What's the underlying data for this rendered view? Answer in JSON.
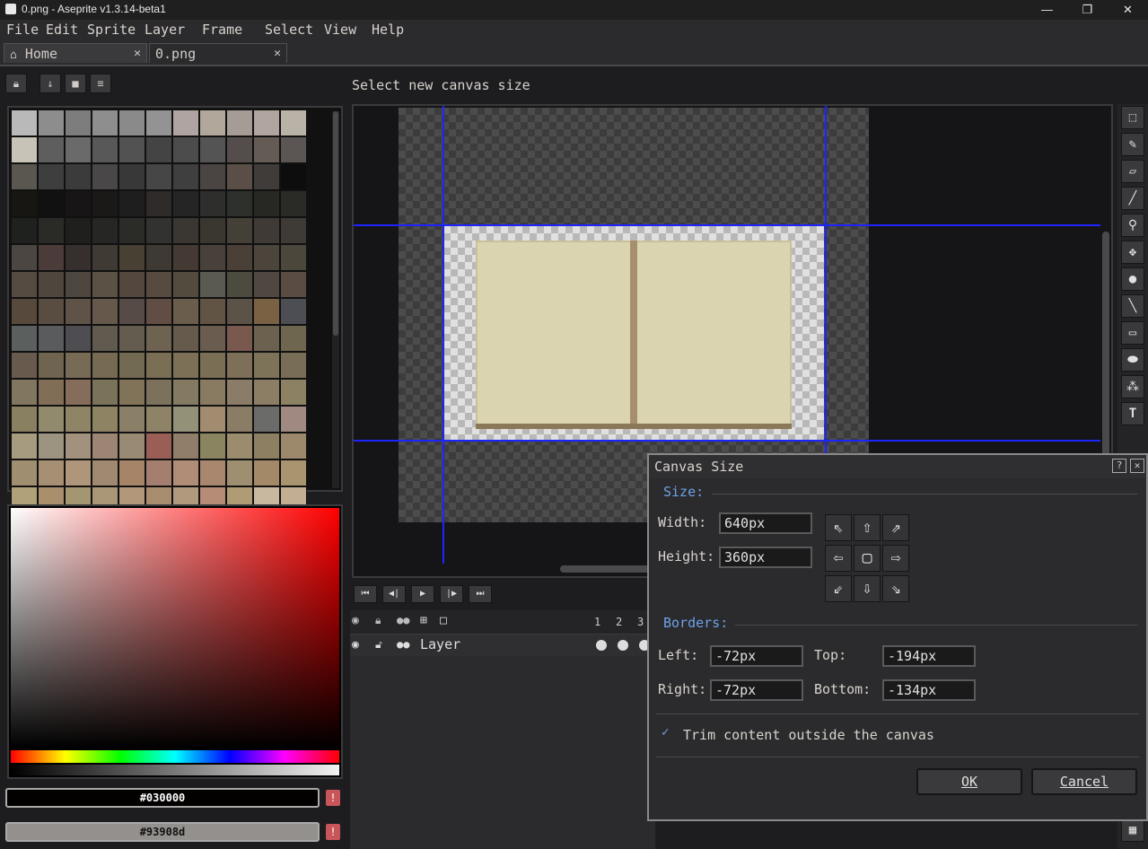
{
  "window": {
    "title": "0.png - Aseprite v1.3.14-beta1",
    "minimize": "—",
    "maximize": "❐",
    "close": "✕"
  },
  "menu": [
    "File",
    "Edit",
    "Sprite",
    "Layer",
    "Frame",
    "Select",
    "View",
    "Help"
  ],
  "tabs": [
    {
      "label": "Home",
      "close": "✕"
    },
    {
      "label": "0.png",
      "close": "✕"
    }
  ],
  "status": "Select new canvas size",
  "palette_colors": [
    "#b9b9b9",
    "#8d8d8d",
    "#7d7d7d",
    "#8e8e8e",
    "#8a8a8a",
    "#939393",
    "#b0a4a3",
    "#b1a89b",
    "#a69c96",
    "#b1a5a0",
    "#b9b2a6",
    "#c7c3b6",
    "#5e5e5e",
    "#6a6a6a",
    "#585858",
    "#525252",
    "#444444",
    "#4c4c4c",
    "#545454",
    "#554c4c",
    "#655b55",
    "#5b5554",
    "#5a5750",
    "#3e3e3e",
    "#3b3b3b",
    "#494747",
    "#383838",
    "#464646",
    "#3f3f3f",
    "#4a4543",
    "#5a4e46",
    "#3f3c3a",
    "#0d0d0d",
    "#171612",
    "#111111",
    "#171515",
    "#1a1918",
    "#1e1e1e",
    "#2e2b28",
    "#252525",
    "#2e2e2c",
    "#2e302c",
    "#272724",
    "#2a2a26",
    "#1f211f",
    "#2a2a27",
    "#1f201e",
    "#262624",
    "#2b2b28",
    "#323230",
    "#3a3632",
    "#3a3731",
    "#444037",
    "#403a36",
    "#3e3a35",
    "#4b4641",
    "#4b3c39",
    "#372f2d",
    "#3f3a33",
    "#474033",
    "#3e3932",
    "#453a33",
    "#48413a",
    "#4b4037",
    "#4c453b",
    "#4c473b",
    "#564b40",
    "#4f463d",
    "#4e473f",
    "#5c5145",
    "#53473e",
    "#574a41",
    "#534b3e",
    "#5a5a52",
    "#4d4a3f",
    "#504740",
    "#5a4c43",
    "#58493d",
    "#584d40",
    "#5e5346",
    "#66594b",
    "#574b47",
    "#624d45",
    "#6b5d4c",
    "#625444",
    "#5b5248",
    "#7a6144",
    "#4c4e54",
    "#5b5f5e",
    "#595b5c",
    "#4e4e52",
    "#605a4f",
    "#655c50",
    "#6e6350",
    "#655a4c",
    "#6a5c4e",
    "#79584e",
    "#6c614f",
    "#6f6650",
    "#685b4d",
    "#6e644f",
    "#786b55",
    "#766a53",
    "#726a52",
    "#7a6e55",
    "#7c7157",
    "#7a6f55",
    "#7e6f59",
    "#7d7358",
    "#786d57",
    "#817760",
    "#826e57",
    "#866c5b",
    "#7a735a",
    "#807358",
    "#7c725c",
    "#847961",
    "#887b62",
    "#8a7c66",
    "#8c7e65",
    "#8d8163",
    "#888060",
    "#918a6c",
    "#8f8566",
    "#8e8363",
    "#8a8068",
    "#8e8367",
    "#939178",
    "#a28c6f",
    "#8b7c66",
    "#6b6b69",
    "#a08981",
    "#a69a7f",
    "#9c9381",
    "#a2917c",
    "#9c8574",
    "#998a73",
    "#9a5e56",
    "#907e6a",
    "#8a8560",
    "#9a8c6d",
    "#8c7f62",
    "#9c896b",
    "#a08e70",
    "#a68f72",
    "#af9579",
    "#9f8970",
    "#a58468",
    "#a47f70",
    "#b08d76",
    "#a8876e",
    "#9e8f70",
    "#a48969",
    "#a8956f",
    "#b1a178",
    "#aa8f6d",
    "#a39671",
    "#a99778",
    "#b3977b",
    "#a88e6e",
    "#b09a7d",
    "#b78c76",
    "#af9b74",
    "#c9b8a0",
    "#c1ae93",
    "#b7a38c",
    "#ad9f83",
    "#bfa98e",
    "#b6a182",
    "#c0a88a",
    "#c7b08f",
    "#b99f82",
    "#c2a98a",
    "#b8a384"
  ],
  "fg_color": "#030000",
  "bg_color": "#93908d",
  "color_warn": "!",
  "tools": [
    "⬚",
    "✎",
    "▱",
    "╱",
    "⚲",
    "✥",
    "●",
    "╲",
    "▭",
    "⬬",
    "⁂",
    "T"
  ],
  "frame_label_icon": "▦",
  "playback": [
    "⏮",
    "◀|",
    "▶",
    "|▶",
    "⏭"
  ],
  "timeline": {
    "frames": [
      "1",
      "2",
      "3"
    ],
    "layer_name": "Layer"
  },
  "dialog": {
    "title": "Canvas Size",
    "help": "?",
    "close": "✕",
    "size_label": "Size:",
    "width_label": "Width:",
    "width_value": "640px",
    "height_label": "Height:",
    "height_value": "360px",
    "anchors": [
      "⇖",
      "⇧",
      "⇗",
      "⇦",
      "▢",
      "⇨",
      "⇙",
      "⇩",
      "⇘"
    ],
    "borders_label": "Borders:",
    "left_label": "Left:",
    "left_value": "-72px",
    "top_label": "Top:",
    "top_value": "-194px",
    "right_label": "Right:",
    "right_value": "-72px",
    "bottom_label": "Bottom:",
    "bottom_value": "-134px",
    "trim_label": "Trim content outside the canvas",
    "trim_checked": true,
    "ok_label": "OK",
    "cancel_label": "Cancel"
  }
}
